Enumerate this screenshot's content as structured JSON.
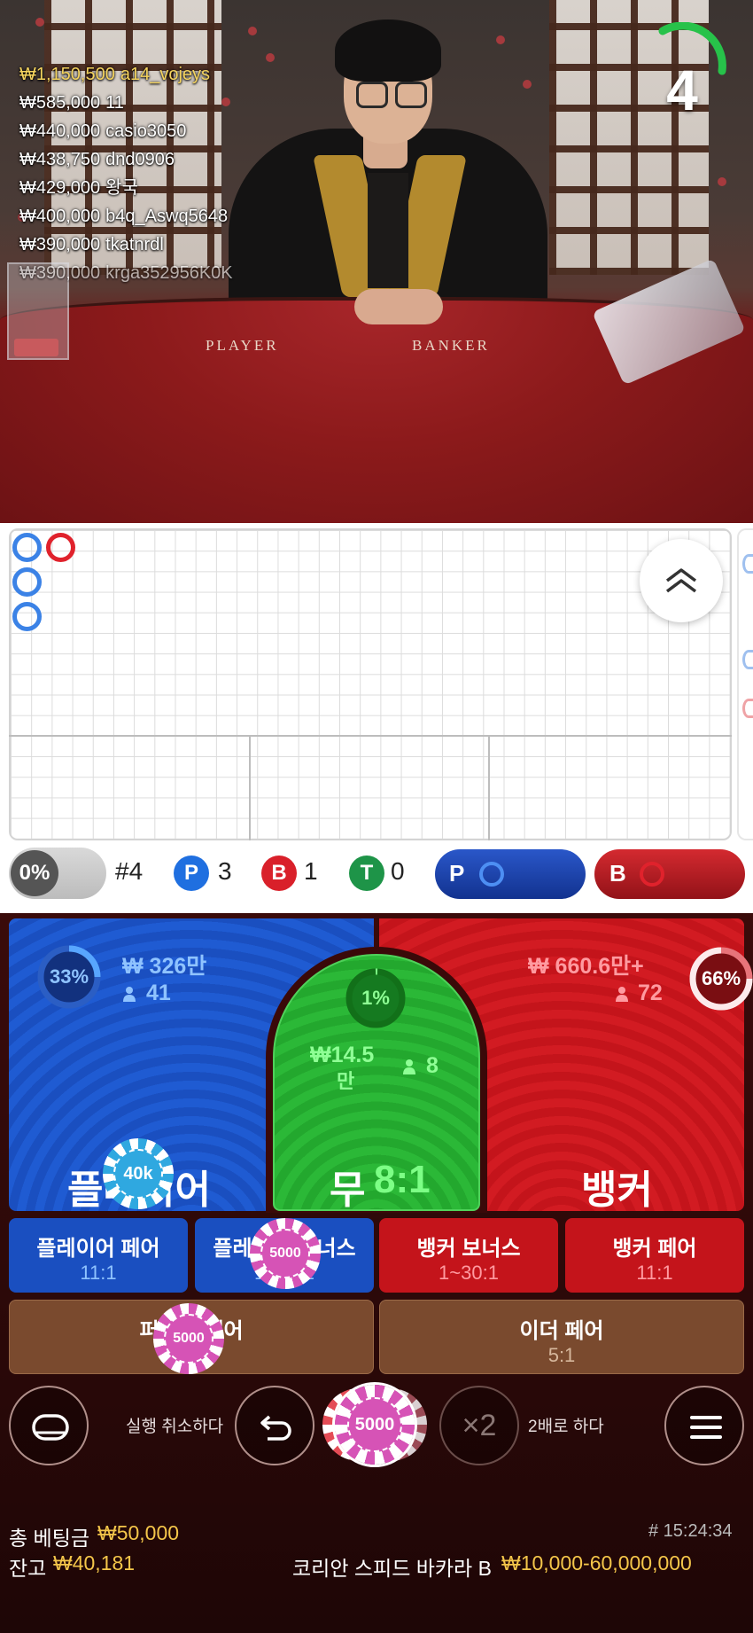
{
  "video": {
    "felt_player": "PLAYER",
    "felt_banker": "BANKER",
    "timer": "4",
    "winners": [
      {
        "amount": "₩1,150,500",
        "name": "a14_vojeys"
      },
      {
        "amount": "₩585,000",
        "name": "11"
      },
      {
        "amount": "₩440,000",
        "name": "casio3050"
      },
      {
        "amount": "₩438,750",
        "name": "dnd0906"
      },
      {
        "amount": "₩429,000",
        "name": "왕국"
      },
      {
        "amount": "₩400,000",
        "name": "b4q_Aswq5648"
      },
      {
        "amount": "₩390,000",
        "name": "tkatnrdl"
      },
      {
        "amount": "₩390,000",
        "name": "krga352956K0K"
      }
    ]
  },
  "stats": {
    "percent": "0%",
    "round": "#4",
    "player_letter": "P",
    "player_count": "3",
    "banker_letter": "B",
    "banker_count": "1",
    "tie_letter": "T",
    "tie_count": "0",
    "predict_player": "P",
    "predict_banker": "B"
  },
  "colors": {
    "player": "#1f5bd2",
    "banker": "#d21b22",
    "tie": "#2bb837",
    "gold": "#f4c64a"
  },
  "bets": {
    "player": {
      "title": "플레이어",
      "amount": "₩ 326만",
      "count": "41",
      "percent": "33%"
    },
    "tie": {
      "title": "무",
      "odds": "8:1",
      "amount": "₩14.5",
      "amount_unit": "만",
      "count": "8",
      "percent": "1%"
    },
    "banker": {
      "title": "뱅커",
      "amount": "₩ 660.6만+",
      "count": "72",
      "percent": "66%"
    },
    "player_pair": {
      "label": "플레이어 페어",
      "odds": "11:1"
    },
    "player_bonus": {
      "label": "플레이어 보너스",
      "odds": "1~30:1"
    },
    "banker_bonus": {
      "label": "뱅커 보너스",
      "odds": "1~30:1"
    },
    "banker_pair": {
      "label": "뱅커 페어",
      "odds": "11:1"
    },
    "perfect_pair": {
      "label": "퍼펙트 페어",
      "odds": "25:1"
    },
    "either_pair": {
      "label": "이더 페어",
      "odds": "5:1"
    }
  },
  "chips": {
    "player": "40k",
    "player_bonus": "5000",
    "perfect_pair": "5000",
    "selected": "5000"
  },
  "controls": {
    "undo_label": "실행 취소하다",
    "double_label": "2배로 하다",
    "double_symbol": "×2"
  },
  "footer": {
    "total_bet_label": "총 베팅금",
    "total_bet_value": "₩50,000",
    "balance_label": "잔고",
    "balance_value": "₩40,181",
    "round_time": "# 15:24:34",
    "table_name": "코리안 스피드 바카라 B",
    "limits": "₩10,000-60,000,000"
  }
}
